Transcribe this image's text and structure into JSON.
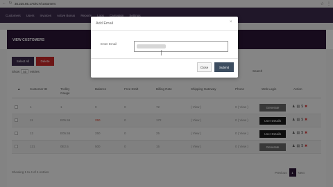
{
  "browser": {
    "url": "35.225.85.174/ICT/customers"
  },
  "nav": {
    "items": [
      "Customers",
      "Users",
      "Invoices",
      "Active Bonus",
      "Reports",
      "Logs",
      "Campaign",
      "Settings"
    ]
  },
  "panel": {
    "title": "VIEW CUSTOMERS"
  },
  "toolbar": {
    "select_all": "Select All",
    "delete": "Delete"
  },
  "table_controls": {
    "show": "Show",
    "entries_value": "50",
    "entries": "entries",
    "search": "Search"
  },
  "table": {
    "headers": [
      "Customer ID",
      "Trolley Gauge",
      "Balance",
      "Free Draft",
      "Billing Rate",
      "Shipping Gateway",
      "Phone",
      "Web Login",
      "Action"
    ],
    "rows": [
      {
        "c1": "1",
        "c2": "1",
        "c3": "0",
        "c4": "0",
        "c5": "72",
        "c6": "( View )",
        "c7": "0 ( View )",
        "web": "Generate",
        "style": "grey",
        "red": false
      },
      {
        "c1": "11",
        "c2": "E05.55",
        "c3": "250",
        "c4": "0",
        "c5": "172",
        "c6": "( View )",
        "c7": "0 ( View )",
        "web": "User Details",
        "style": "dark",
        "red": true
      },
      {
        "c1": "12",
        "c2": "E05.55",
        "c3": "250",
        "c4": "0",
        "c5": "25",
        "c6": "( View )",
        "c7": "0 ( View )",
        "web": "User Details",
        "style": "dark",
        "red": false
      },
      {
        "c1": "131",
        "c2": "0E2.5",
        "c3": "500",
        "c4": "0",
        "c5": "15",
        "c6": "( View )",
        "c7": "0 ( View )",
        "web": "Generate",
        "style": "grey",
        "red": false
      }
    ]
  },
  "footer": {
    "info": "Showing 1 to 4 of 4 entries",
    "prev": "Previous",
    "page": "1",
    "next": "Next"
  },
  "modal": {
    "title": "Add Email",
    "close_x": "×",
    "email_label": "Enter Email",
    "close_button": "Close",
    "submit_button": "Submit"
  }
}
